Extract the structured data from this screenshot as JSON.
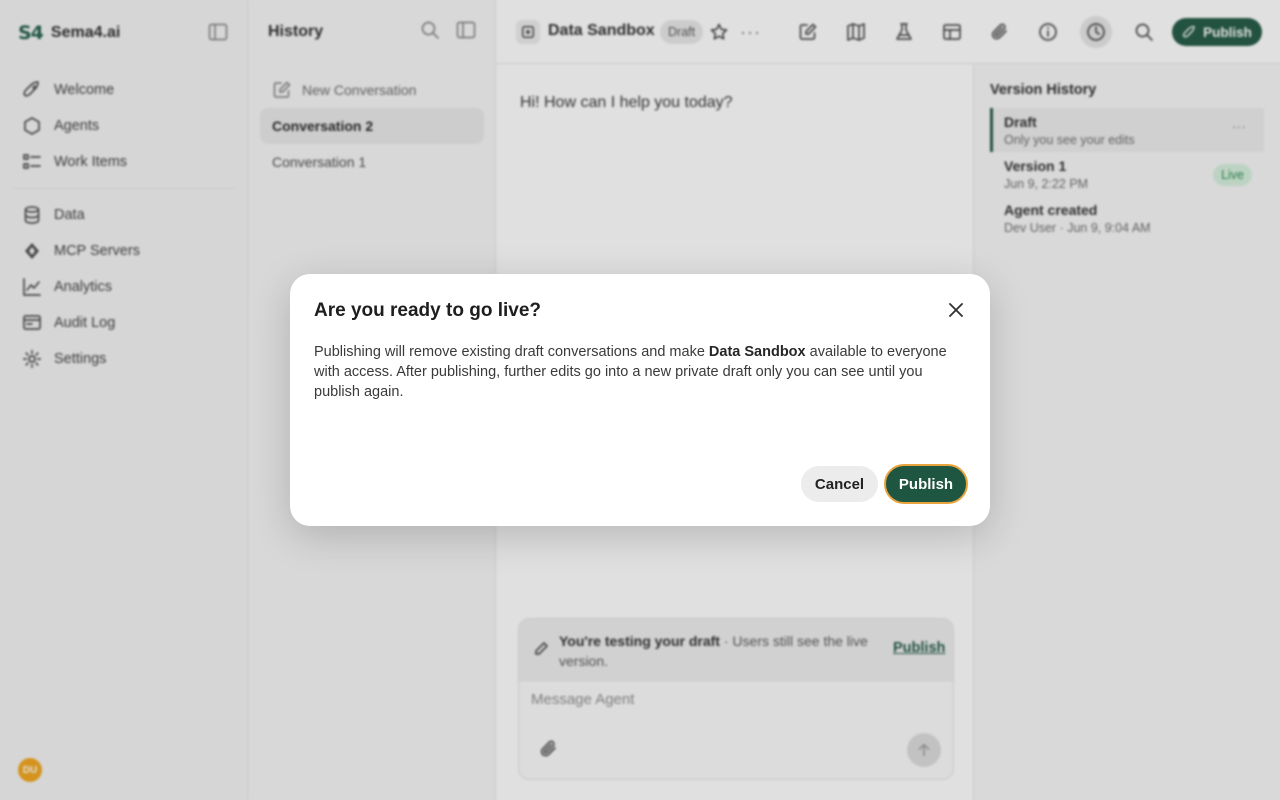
{
  "brand": {
    "logo": "S4",
    "name": "Sema4.ai"
  },
  "nav": {
    "primary": [
      {
        "label": "Welcome",
        "icon": "rocket-icon"
      },
      {
        "label": "Agents",
        "icon": "hexagon-icon"
      },
      {
        "label": "Work Items",
        "icon": "list-icon"
      }
    ],
    "secondary": [
      {
        "label": "Data",
        "icon": "database-icon"
      },
      {
        "label": "MCP Servers",
        "icon": "mcp-icon"
      },
      {
        "label": "Analytics",
        "icon": "chart-icon"
      },
      {
        "label": "Audit Log",
        "icon": "audit-icon"
      },
      {
        "label": "Settings",
        "icon": "gear-icon"
      }
    ],
    "avatar": "DU"
  },
  "history": {
    "title": "History",
    "items": [
      {
        "label": "New Conversation"
      },
      {
        "label": "Conversation 2"
      },
      {
        "label": "Conversation 1"
      }
    ]
  },
  "toolbar": {
    "agent_name": "Data Sandbox",
    "status": "Draft",
    "more": "···",
    "publish_label": "Publish"
  },
  "chat": {
    "greeting": "Hi! How can I help you today?",
    "banner_strong": "You're testing your draft",
    "banner_rest": " · Users still see the live version.",
    "banner_link": "Publish",
    "composer_placeholder": "Message Agent"
  },
  "versions": {
    "title": "Version History",
    "items": [
      {
        "name": "Draft",
        "sub": "Only you see your edits",
        "badge": ""
      },
      {
        "name": "Version 1",
        "sub": "Jun 9, 2:22 PM",
        "badge": "Live"
      },
      {
        "name": "Agent created",
        "sub": "Dev User · Jun 9, 9:04 AM",
        "badge": ""
      }
    ]
  },
  "modal": {
    "title": "Are you ready to go live?",
    "body_before": "Publishing will remove existing draft conversations and make ",
    "body_strong": "Data Sandbox",
    "body_after": " available to everyone with access. After publishing, further edits go into a new private draft only you can see until you publish again.",
    "cancel_label": "Cancel",
    "publish_label": "Publish"
  },
  "colors": {
    "brand_green": "#1e5641",
    "live_green": "#2f8a4f",
    "focus_ring": "#e8a33d",
    "avatar": "#f1a417"
  }
}
